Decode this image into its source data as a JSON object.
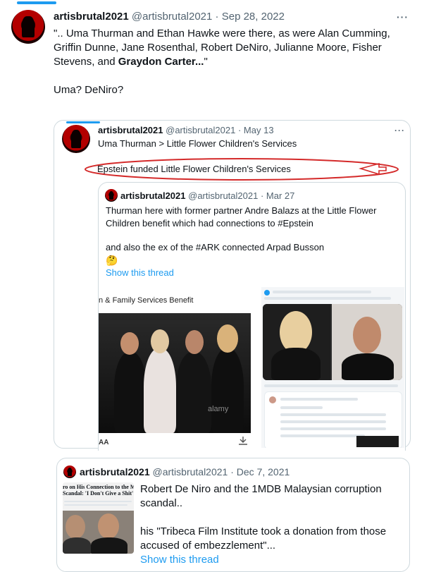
{
  "main_tweet": {
    "name": "artisbrutal2021",
    "handle": "@artisbrutal2021",
    "sep": "·",
    "date": "Sep 28, 2022",
    "more": "···",
    "text_line1": "\".. Uma Thurman and Ethan Hawke were there, as were Alan Cumming,",
    "text_line2": "Griffin Dunne, Jane Rosenthal, Robert DeNiro, Julianne Moore, Fisher",
    "text_line3_plain": "Stevens, and ",
    "text_line3_bold": "Graydon Carter...",
    "text_line3_end": "\"",
    "question": "Uma? DeNiro?"
  },
  "quote1": {
    "name": "artisbrutal2021",
    "handle": "@artisbrutal2021",
    "sep": "·",
    "date": "May 13",
    "more": "···",
    "text": "Uma Thurman > Little Flower Children's Services",
    "annotation": "Epstein funded Little Flower Children's Services"
  },
  "quote2": {
    "name": "artisbrutal2021",
    "handle": "@artisbrutal2021",
    "sep": "·",
    "date": "Mar 27",
    "line1": "Thurman here with former partner Andre Balazs at the Little Flower",
    "line2": "Children benefit which had connections to #Epstein",
    "line3": "and also the ex of the #ARK connected Arpad Busson",
    "emoji": "🤔",
    "show_thread": "Show this thread",
    "image_caption": "n & Family Services Benefit",
    "image_watermark": "alamy",
    "image_corner": "AA"
  },
  "quote3": {
    "name": "artisbrutal2021",
    "handle": "@artisbrutal2021",
    "sep": "·",
    "date": "Dec 7, 2021",
    "line1": "Robert De Niro and the 1MDB Malaysian corruption",
    "line2": "scandal..",
    "line3": "his \"Tribeca Film Institute took a donation from those",
    "line4": "accused of embezzlement\"...",
    "show_thread": "Show this thread",
    "thumb_head1": "ro on His Connection to the M",
    "thumb_head2": "Scandal: 'I Don't Give a Shit'"
  },
  "colors": {
    "accent": "#1d9bf0",
    "annotation": "#d42a2a",
    "border": "#cfd9de",
    "muted": "#536471"
  }
}
